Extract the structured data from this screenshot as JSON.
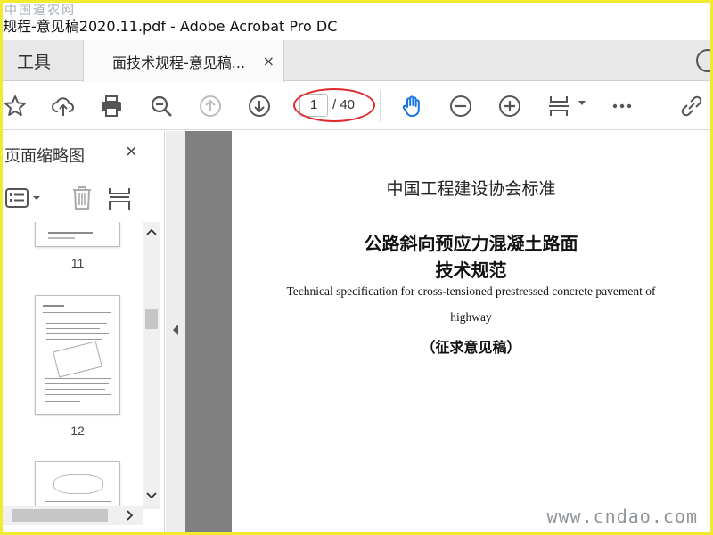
{
  "window": {
    "title": "规程-意见稿2020.11.pdf - Adobe Acrobat Pro DC",
    "watermark_top": "中国道农网",
    "watermark_bottom": "www.cndao.com"
  },
  "tabs": {
    "tools_label": "工具",
    "doc_label": "面技术规程-意见稿...",
    "doc_close": "×"
  },
  "toolbar": {
    "current_page": "1",
    "total_pages": "/ 40",
    "icons": [
      "star-icon",
      "cloud-upload-icon",
      "print-icon",
      "zoom-search-icon",
      "page-up-icon",
      "page-down-icon",
      "hand-tool-icon",
      "zoom-out-icon",
      "zoom-in-icon",
      "fit-page-icon",
      "more-icon",
      "share-link-icon"
    ],
    "annotation_color": "#e0262a"
  },
  "thumbnails_pane": {
    "title": "页面缩略图",
    "close": "×",
    "pages": [
      {
        "label": "11"
      },
      {
        "label": "12"
      }
    ]
  },
  "document": {
    "organization": "中国工程建设协会标准",
    "title_line1": "公路斜向预应力混凝土路面",
    "title_line2": "技术规范",
    "english_line1": "Technical specification for cross-tensioned prestressed concrete pavement of",
    "english_line2": "highway",
    "status": "（征求意见稿）"
  },
  "colors": {
    "frame": "#f2ea2e",
    "hand_tool": "#1473e6",
    "canvas_gray": "#808080"
  }
}
